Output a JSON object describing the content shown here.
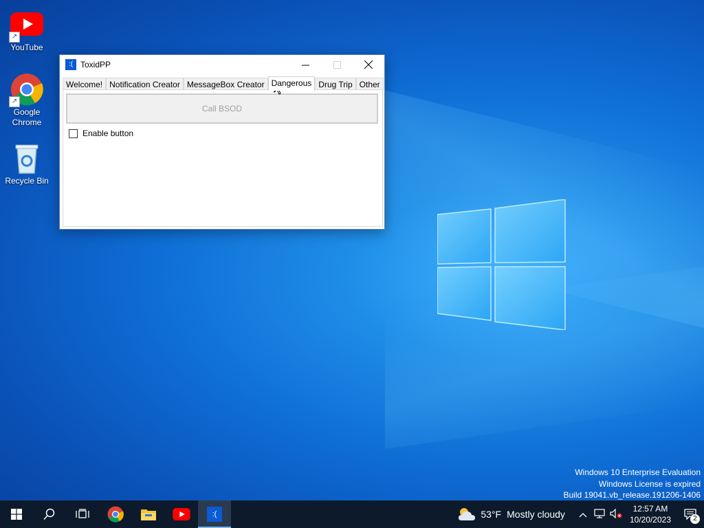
{
  "desktop": {
    "icons": [
      {
        "label": "YouTube"
      },
      {
        "label": "Google\nChrome"
      },
      {
        "label": "Recycle Bin"
      }
    ]
  },
  "window": {
    "title": "ToxidPP",
    "icon_glyph": ":(",
    "tabs": [
      "Welcome!",
      "Notification Creator",
      "MessageBox Creator",
      "Dangerous",
      "Drug Trip",
      "Other"
    ],
    "active_tab": "Dangerous",
    "bsod_button_label": "Call BSOD",
    "enable_checkbox_label": "Enable button"
  },
  "watermark": {
    "line1": "Windows 10 Enterprise Evaluation",
    "line2": "Windows License is expired",
    "line3": "Build 19041.vb_release.191206-1406"
  },
  "taskbar": {
    "weather_temp": "53°F",
    "weather_desc": "Mostly cloudy",
    "time": "12:57 AM",
    "date": "10/20/2023",
    "notification_count": "2",
    "app_glyph": ":("
  },
  "colors": {
    "accent": "#0a5bd4",
    "taskbar": "#0d1a2b"
  }
}
